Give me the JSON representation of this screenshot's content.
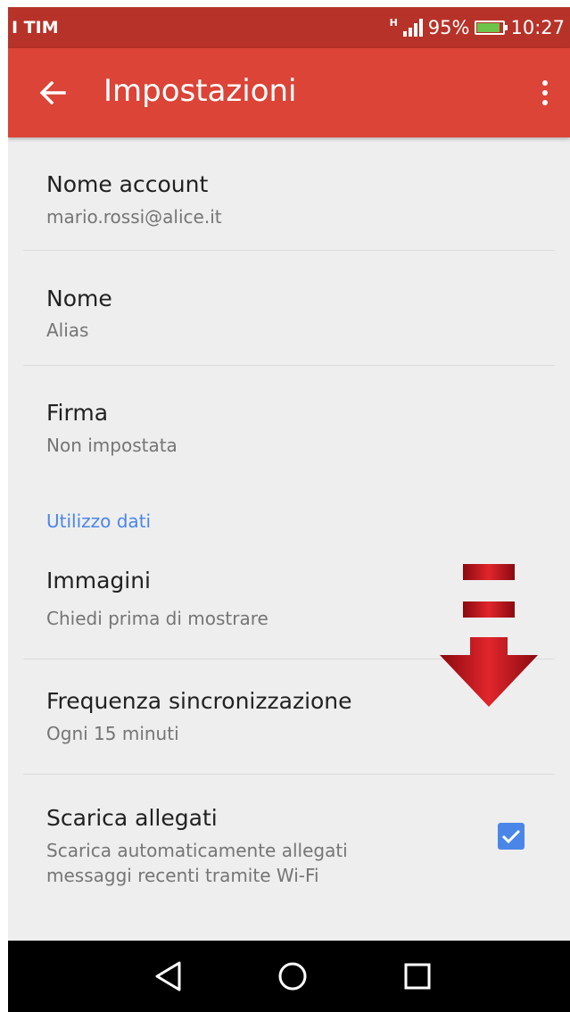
{
  "status_bar": {
    "carrier": "I TIM",
    "network": "H",
    "battery": "95%",
    "battery_level": 0.95,
    "time": "10:27"
  },
  "app_bar": {
    "title": "Impostazioni",
    "back_icon": "arrow-left-icon",
    "menu_icon": "more-vert-icon"
  },
  "settings": {
    "account_name": {
      "title": "Nome account",
      "value": "mario.rossi@alice.it"
    },
    "name": {
      "title": "Nome",
      "value": "Alias"
    },
    "signature": {
      "title": "Firma",
      "value": "Non impostata"
    },
    "section_data_usage": "Utilizzo dati",
    "images": {
      "title": "Immagini",
      "value": "Chiedi prima di mostrare"
    },
    "sync_frequency": {
      "title": "Frequenza sincronizzazione",
      "value": "Ogni 15 minuti"
    },
    "download_attachments": {
      "title": "Scarica allegati",
      "description_line1": "Scarica automaticamente allegati",
      "description_line2": "messaggi recenti tramite Wi-Fi",
      "checked": true
    }
  },
  "nav_bar": {
    "back_icon": "nav-back-triangle-icon",
    "home_icon": "nav-home-circle-icon",
    "recents_icon": "nav-recents-square-icon"
  },
  "colors": {
    "app_bar": "#db4437",
    "status_bar": "#b73228",
    "accent": "#4a86e8",
    "background": "#eeeeee",
    "annotation_arrow": "#c0121c"
  }
}
